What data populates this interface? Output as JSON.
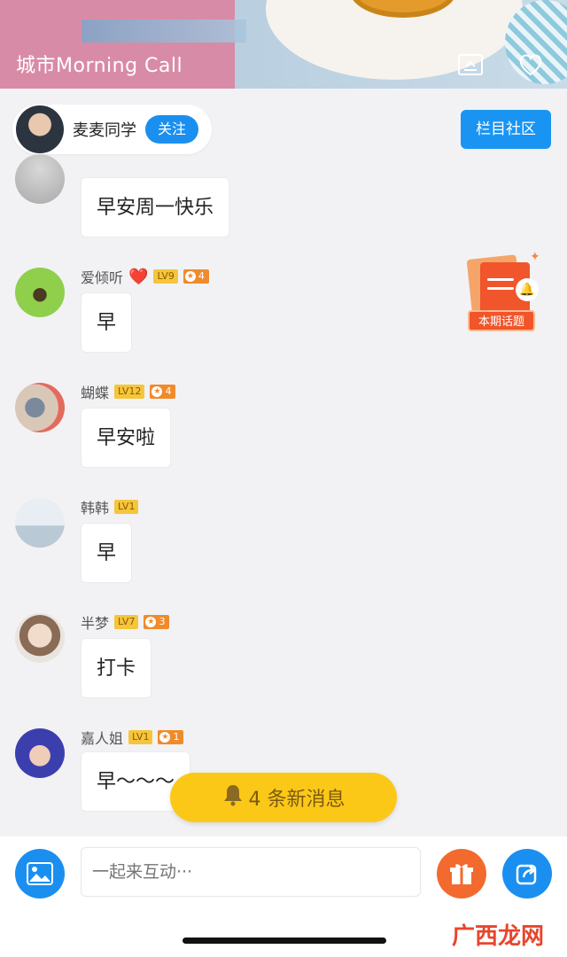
{
  "banner": {
    "title": "城市Morning  Call"
  },
  "host": {
    "name": "麦麦同学",
    "follow_label": "关注"
  },
  "community_label": "栏目社区",
  "topic_label": "本期话题",
  "messages": [
    {
      "name": "",
      "level": "",
      "stars": "",
      "text": "早安周一快乐"
    },
    {
      "name": "爱倾听",
      "emoji": "❤️",
      "level": "LV9",
      "stars": "4",
      "text": "早"
    },
    {
      "name": "蝴蝶",
      "level": "LV12",
      "stars": "4",
      "text": "早安啦"
    },
    {
      "name": "韩韩",
      "level": "LV1",
      "stars": "",
      "text": "早"
    },
    {
      "name": "半梦",
      "level": "LV7",
      "stars": "3",
      "text": "打卡"
    },
    {
      "name": "嘉人姐",
      "level": "LV1",
      "stars": "1",
      "text": "早～～～"
    }
  ],
  "toast": {
    "text": "4 条新消息"
  },
  "input": {
    "placeholder": "一起来互动···"
  },
  "watermark": "广西龙网",
  "colors": {
    "accent_blue": "#1a8ff0",
    "toast_yellow": "#fbc818",
    "gift_orange": "#f26a2e"
  }
}
